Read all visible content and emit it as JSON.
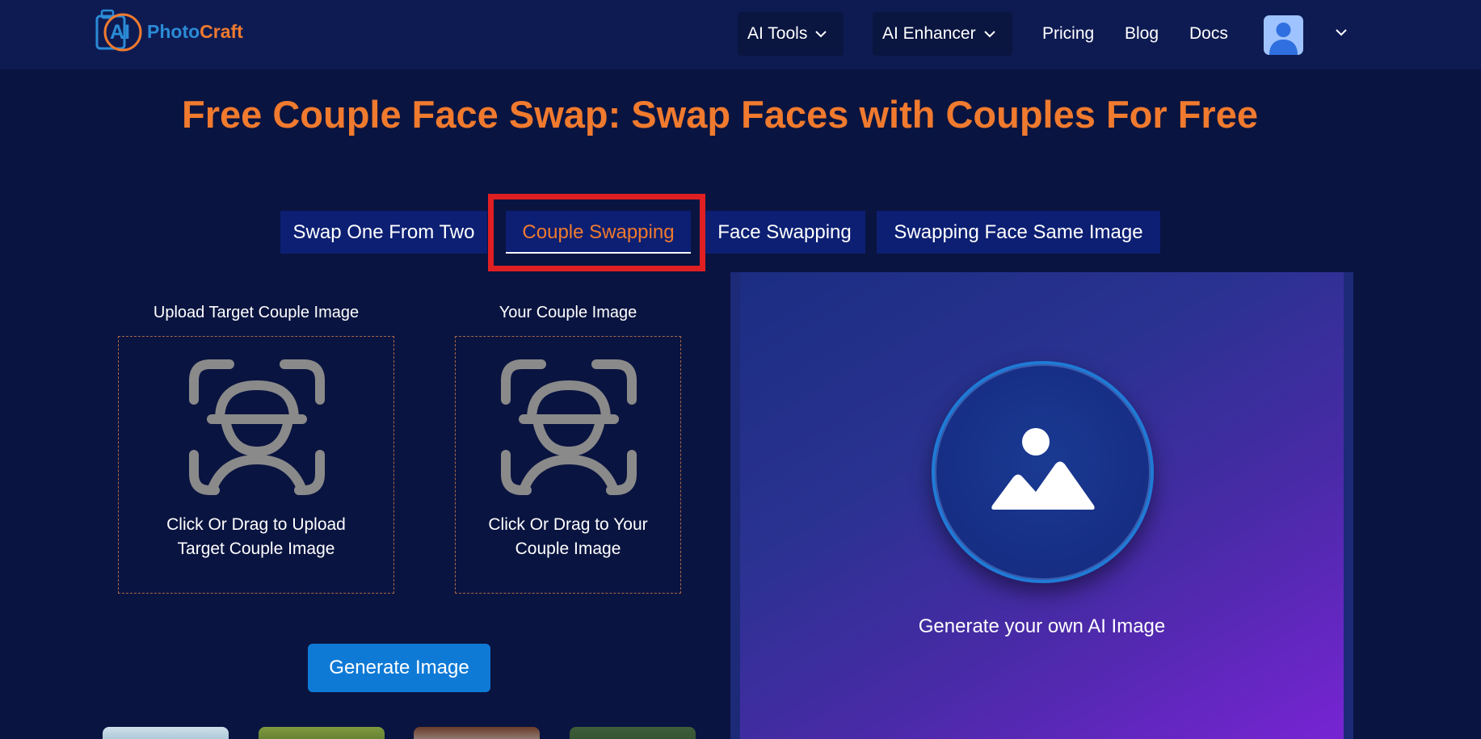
{
  "nav": {
    "logo_ai": "AI",
    "logo_part1": "Photo",
    "logo_part2": "Craft",
    "ai_tools": "AI Tools",
    "ai_enhancer": "AI Enhancer",
    "pricing": "Pricing",
    "blog": "Blog",
    "docs": "Docs"
  },
  "title": "Free Couple Face Swap: Swap Faces with Couples For Free",
  "tabs": [
    {
      "label": "Swap One From Two",
      "active": false
    },
    {
      "label": "Couple Swapping",
      "active": true
    },
    {
      "label": "Face Swapping",
      "active": false
    },
    {
      "label": "Swapping Face Same Image",
      "active": false
    }
  ],
  "uploads": {
    "target": {
      "label": "Upload Target Couple Image",
      "hint_line1": "Click Or Drag to Upload",
      "hint_line2": "Target Couple Image",
      "icon": "face-scan-icon"
    },
    "yours": {
      "label": "Your Couple Image",
      "hint_line1": "Click Or Drag to Your",
      "hint_line2": "Couple Image",
      "icon": "face-scan-icon"
    }
  },
  "generate_button": "Generate Image",
  "result": {
    "caption": "Generate your own AI Image",
    "icon": "image-placeholder-icon"
  },
  "colors": {
    "background": "#0a1440",
    "navbar": "#0e1b52",
    "accent_orange": "#f07a2e",
    "button_blue": "#0f7ad6",
    "tab_bg": "#0c1f73",
    "highlight_red": "#e01f22"
  }
}
